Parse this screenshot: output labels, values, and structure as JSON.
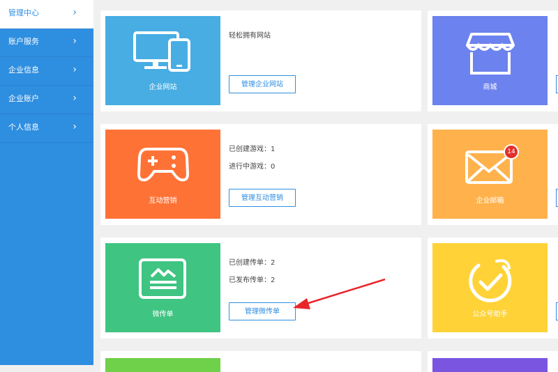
{
  "sidebar": {
    "items": [
      {
        "label": "管理中心",
        "active": true
      },
      {
        "label": "账户服务"
      },
      {
        "label": "企业信息"
      },
      {
        "label": "企业账户"
      },
      {
        "label": "个人信息"
      }
    ],
    "chevron": "›"
  },
  "cards": {
    "website": {
      "tile_label": "企业网站",
      "color": "#47ade3",
      "info": [
        "轻松拥有网站"
      ],
      "button": "管理企业网站"
    },
    "shop": {
      "tile_label": "商城",
      "color": "#6c82ee"
    },
    "game": {
      "tile_label": "互动营销",
      "color": "#ff7236",
      "info": [
        "已创建游戏：1",
        "进行中游戏：0"
      ],
      "button": "管理互动营销"
    },
    "mail": {
      "tile_label": "企业邮箱",
      "color": "#ffb24c",
      "badge": "14"
    },
    "flyer": {
      "tile_label": "微传单",
      "color": "#3fc482",
      "info": [
        "已创建传单：2",
        "已发布传单：2"
      ],
      "button": "管理微传单"
    },
    "wechat": {
      "tile_label": "公众号助手",
      "color": "#ffd338"
    }
  },
  "colors": {
    "sidebar": "#2e8ee0",
    "arrow": "#e8262a",
    "bottom_green": "#6fd04a",
    "bottom_purple": "#7a55e0"
  },
  "icons": {
    "website": "monitor-phone-icon",
    "shop": "storefront-icon",
    "game": "gamepad-icon",
    "mail": "envelope-icon",
    "flyer": "flyer-icon",
    "wechat": "check-circle-icon"
  }
}
